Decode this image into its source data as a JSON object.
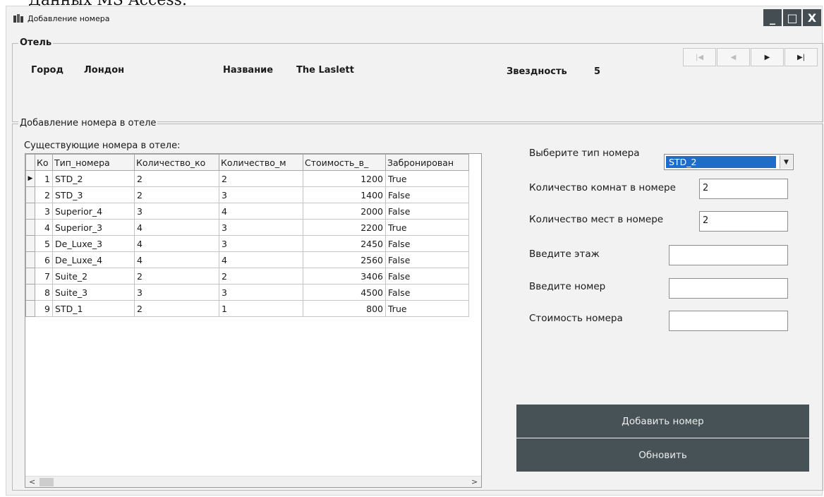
{
  "page_fragment": "Данных MS Access.",
  "window": {
    "title": "Добавление номера",
    "controls": [
      "_",
      "□",
      "X"
    ]
  },
  "hotel": {
    "legend": "Отель",
    "city_label": "Город",
    "city_value": "Лондон",
    "name_label": "Название",
    "name_value": "The Laslett",
    "stars_label": "Звездность",
    "stars_value": "5",
    "navigator": [
      "|◀",
      "◀",
      "▶",
      "▶|"
    ]
  },
  "add_room": {
    "legend": "Добавление номера в отеле",
    "grid_caption": "Существующие номера в отеле:",
    "columns": [
      "Ко",
      "Тип_номера",
      "Количество_ко",
      "Количество_м",
      "Стоимость_в_",
      "Забронирован"
    ],
    "rows": [
      [
        "1",
        "STD_2",
        "2",
        "2",
        "1200",
        "True"
      ],
      [
        "2",
        "STD_3",
        "2",
        "3",
        "1400",
        "False"
      ],
      [
        "3",
        "Superior_4",
        "3",
        "4",
        "2000",
        "False"
      ],
      [
        "4",
        "Superior_3",
        "4",
        "3",
        "2200",
        "True"
      ],
      [
        "5",
        "De_Luxe_3",
        "4",
        "3",
        "2450",
        "False"
      ],
      [
        "6",
        "De_Luxe_4",
        "4",
        "4",
        "2560",
        "False"
      ],
      [
        "7",
        "Suite_2",
        "2",
        "2",
        "3406",
        "False"
      ],
      [
        "8",
        "Suite_3",
        "3",
        "3",
        "4500",
        "False"
      ],
      [
        "9",
        "STD_1",
        "2",
        "1",
        "800",
        "True"
      ]
    ],
    "current_row_marker": "▶"
  },
  "form": {
    "room_type_label": "Выберите тип номера",
    "room_type_value": "STD_2",
    "rooms_count_label": "Количество комнат в номере",
    "rooms_count_value": "2",
    "places_count_label": "Количество мест в номере",
    "places_count_value": "2",
    "floor_label": "Введите этаж",
    "floor_value": "",
    "number_label": "Введите номер",
    "number_value": "",
    "cost_label": "Стоимость номера",
    "cost_value": ""
  },
  "buttons": {
    "add": "Добавить номер",
    "refresh": "Обновить"
  }
}
